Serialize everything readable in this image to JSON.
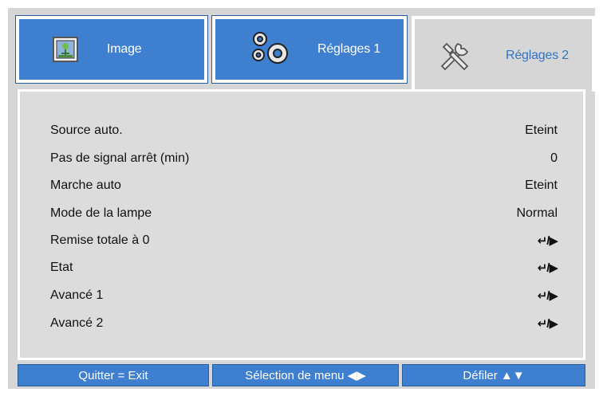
{
  "tabs": [
    {
      "label": "Image",
      "icon": "image-icon",
      "active": false
    },
    {
      "label": "Réglages 1",
      "icon": "gears-icon",
      "active": false
    },
    {
      "label": "Réglages 2",
      "icon": "tools-icon",
      "active": true
    }
  ],
  "settings": [
    {
      "label": "Source auto.",
      "value": "Eteint"
    },
    {
      "label": "Pas de signal arrêt (min)",
      "value": "0"
    },
    {
      "label": "Marche auto",
      "value": "Eteint"
    },
    {
      "label": "Mode de la lampe",
      "value": "Normal"
    },
    {
      "label": "Remise totale à 0",
      "value": "↵/▶"
    },
    {
      "label": "Etat",
      "value": "↵/▶"
    },
    {
      "label": "Avancé 1",
      "value": "↵/▶"
    },
    {
      "label": "Avancé 2",
      "value": "↵/▶"
    }
  ],
  "footer": {
    "exit_label": "Quitter = Exit",
    "menu_select_label": "Sélection de menu ◀▶",
    "scroll_label": "Défiler ▲▼"
  },
  "colors": {
    "tab_blue": "#3e7fcf",
    "active_text": "#2f74c6",
    "panel_gray": "#dcdcdc"
  }
}
